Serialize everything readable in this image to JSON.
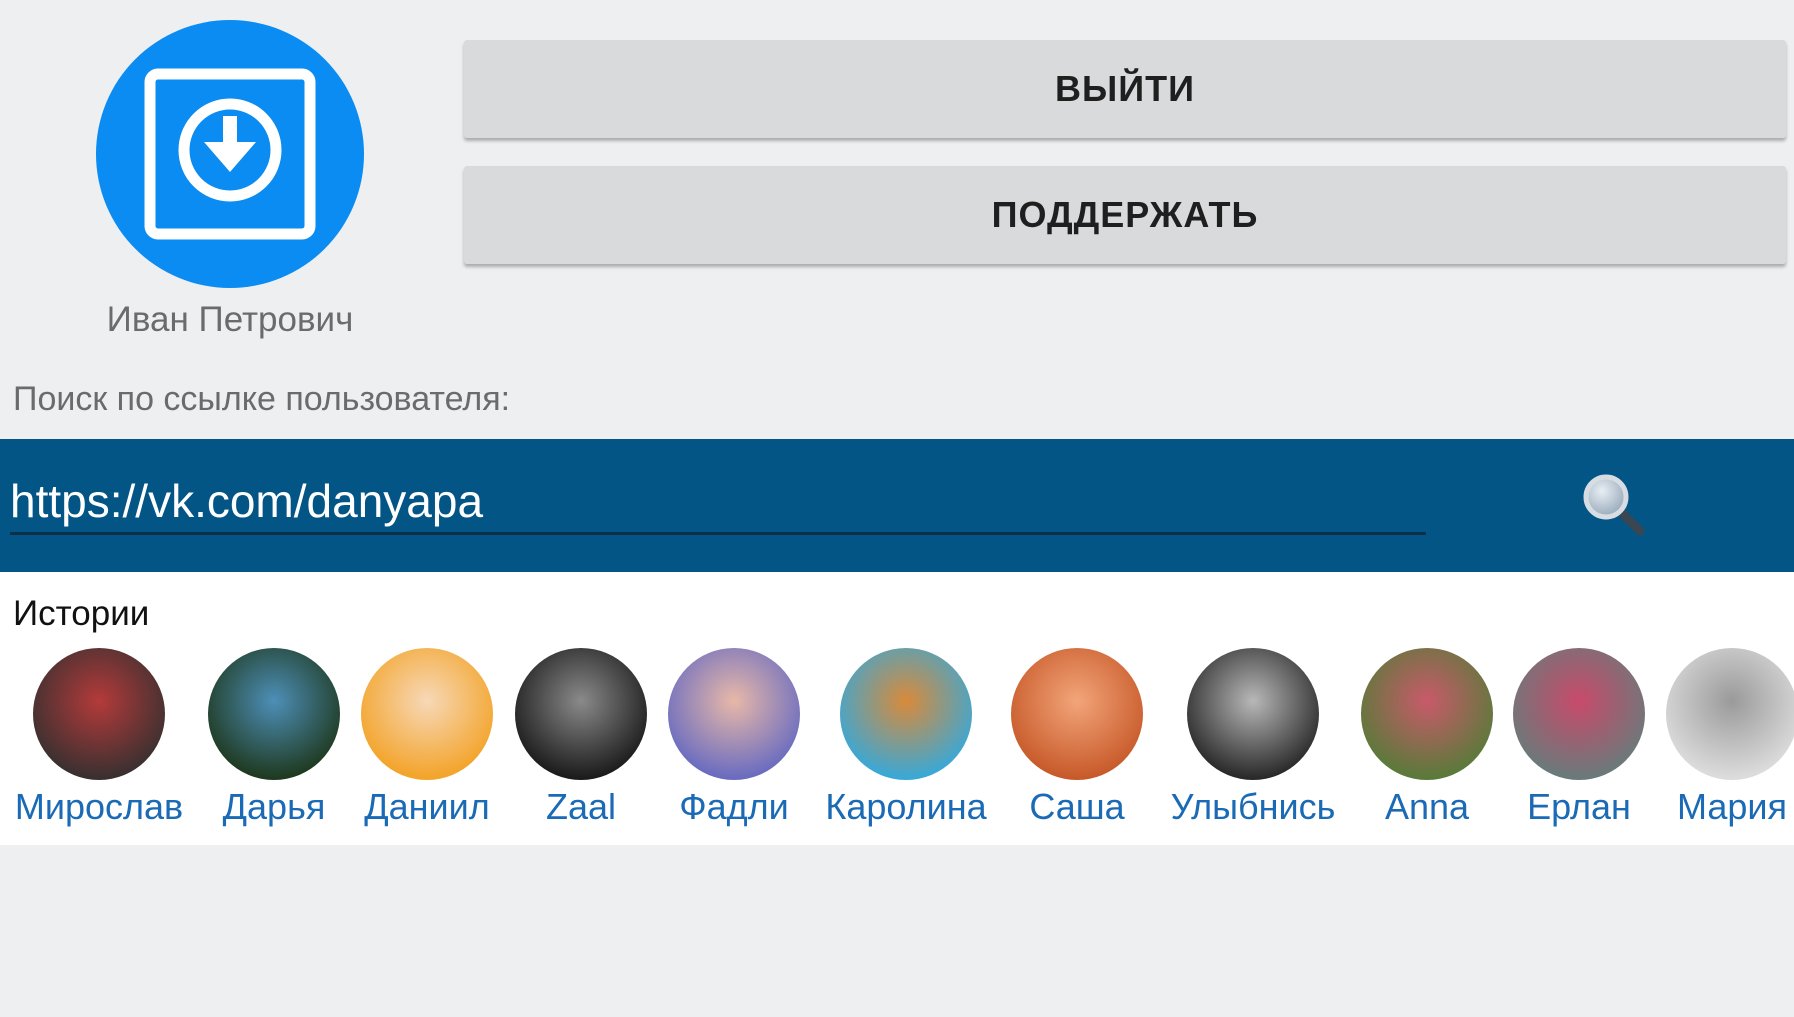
{
  "profile": {
    "name": "Иван Петрович",
    "avatar_icon": "download-box-icon",
    "avatar_color": "#0a8cf2"
  },
  "buttons": {
    "logout_label": "ВЫЙТИ",
    "support_label": "ПОДДЕРЖАТЬ"
  },
  "search": {
    "label": "Поиск по ссылке пользователя:",
    "value": "https://vk.com/danyapa",
    "icon": "search-icon",
    "bar_color": "#035586"
  },
  "stories": {
    "title": "Истории",
    "items": [
      {
        "name": "Мирослав",
        "colors": [
          "#3a3030",
          "#b43a3a"
        ]
      },
      {
        "name": "Дарья",
        "colors": [
          "#1f3a20",
          "#4d8fb8"
        ]
      },
      {
        "name": "Даниил",
        "colors": [
          "#f3a42a",
          "#f7d8b8"
        ]
      },
      {
        "name": "Zaal",
        "colors": [
          "#1c1c1c",
          "#8a8a8a"
        ]
      },
      {
        "name": "Фадли",
        "colors": [
          "#6a6cc0",
          "#e8b8a8"
        ]
      },
      {
        "name": "Каролина",
        "colors": [
          "#3aa8d6",
          "#d98a3a"
        ]
      },
      {
        "name": "Саша",
        "colors": [
          "#c85a2a",
          "#f2a57a"
        ]
      },
      {
        "name": "Улыбнись",
        "colors": [
          "#2a2a2a",
          "#b8b8b8"
        ]
      },
      {
        "name": "Anna",
        "colors": [
          "#5a7a3a",
          "#c85a6a"
        ]
      },
      {
        "name": "Ерлан",
        "colors": [
          "#6a7a7a",
          "#c84a6a"
        ]
      },
      {
        "name": "Мария",
        "colors": [
          "#dcdcdc",
          "#9a9a9a"
        ]
      }
    ]
  }
}
